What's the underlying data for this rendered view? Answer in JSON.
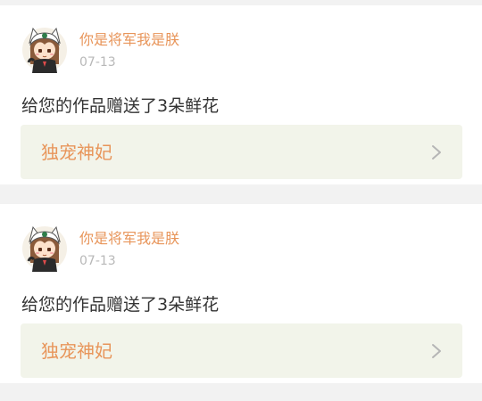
{
  "notifications": [
    {
      "user": "你是将军我是朕",
      "date": "07-13",
      "message": "给您的作品赠送了3朵鲜花",
      "work_title": "独宠神妃",
      "avatar_icon": "anime-girl-avatar-icon",
      "chevron_icon": "chevron-right-icon"
    },
    {
      "user": "你是将军我是朕",
      "date": "07-13",
      "message": "给您的作品赠送了3朵鲜花",
      "work_title": "独宠神妃",
      "avatar_icon": "anime-girl-avatar-icon",
      "chevron_icon": "chevron-right-icon"
    }
  ],
  "colors": {
    "username": "#e8955a",
    "date": "#b8b8b8",
    "message": "#333333",
    "work_link_bg": "#f2f4ea",
    "page_bg": "#f2f2f2"
  }
}
